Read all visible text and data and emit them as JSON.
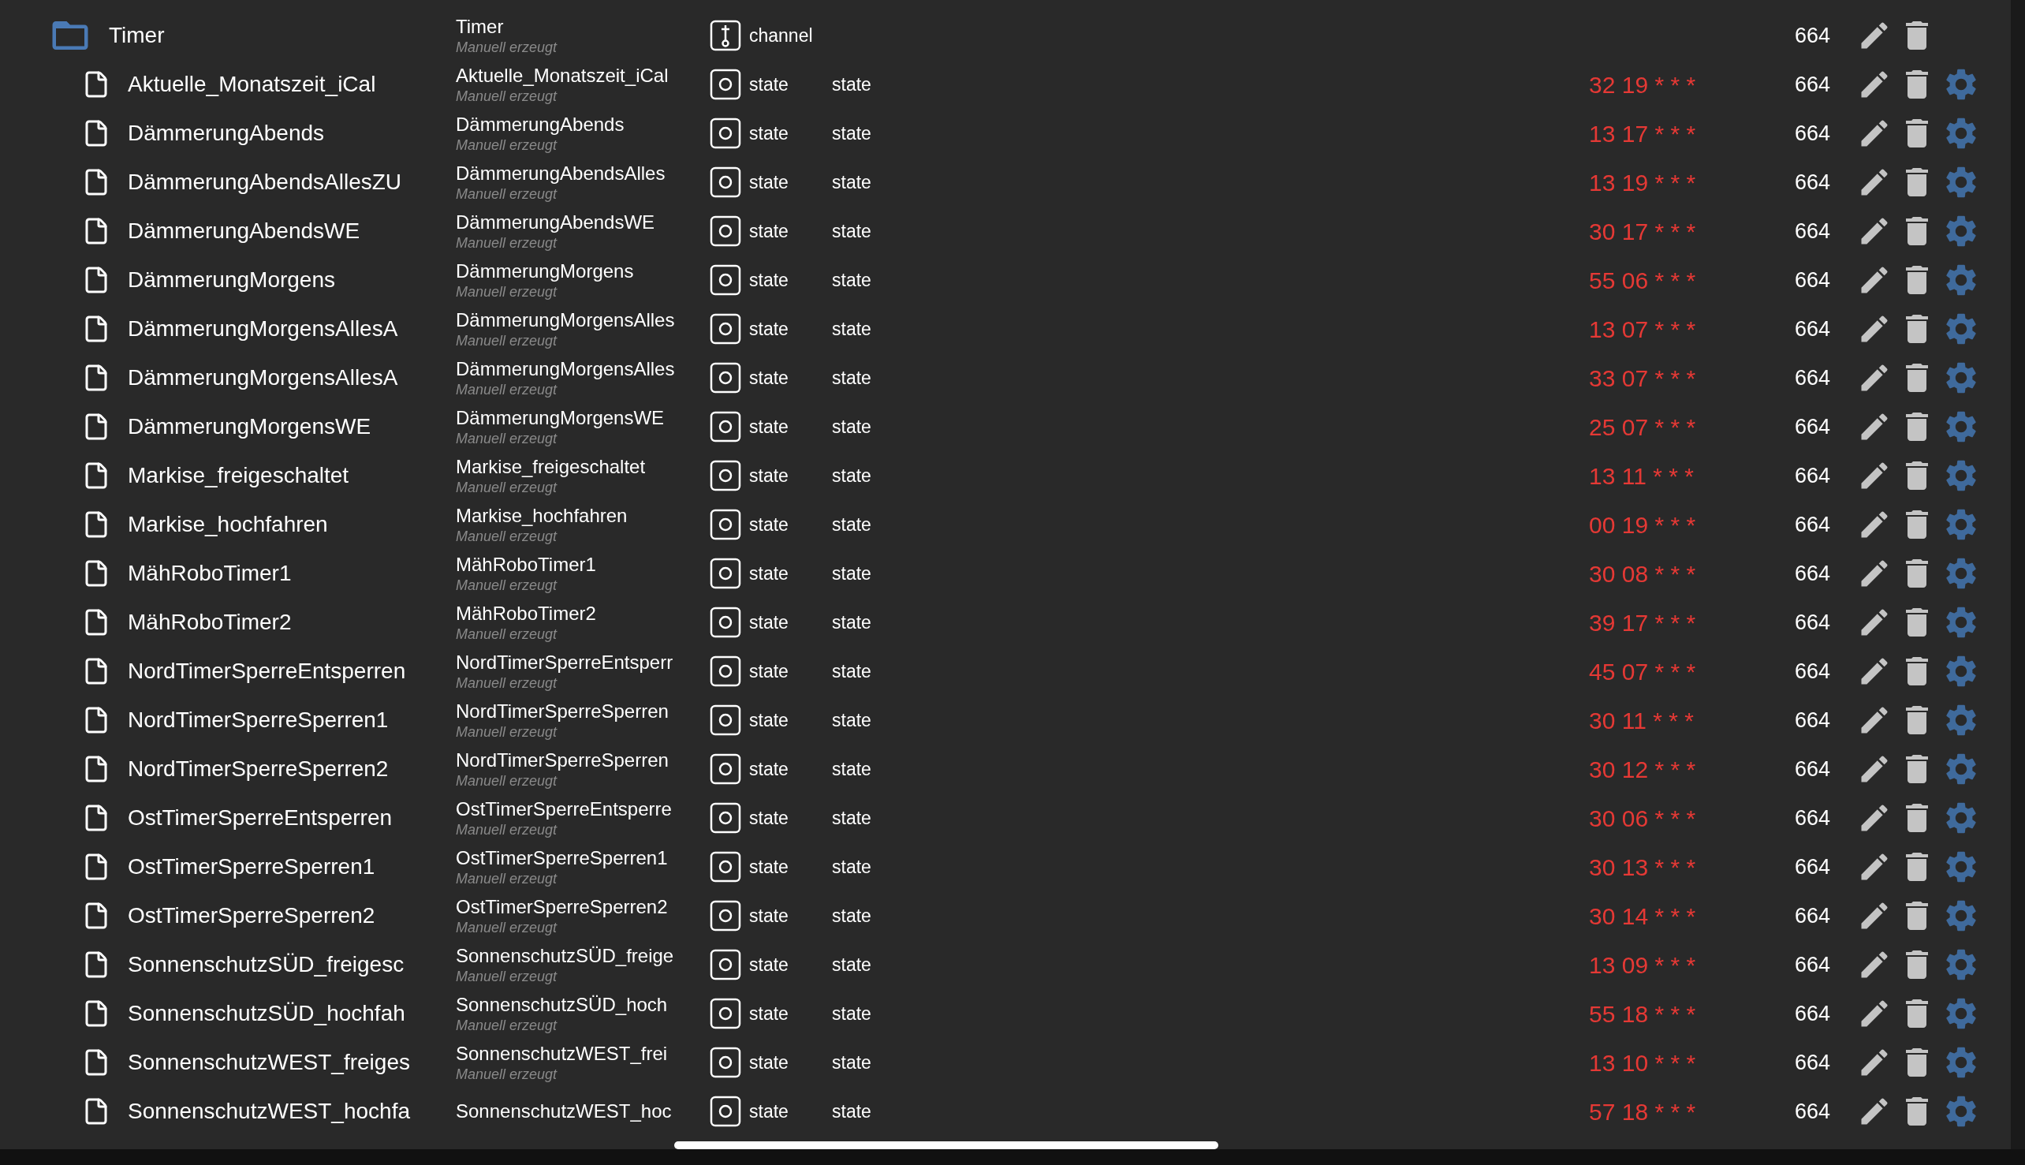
{
  "tree": {
    "kind": "channel",
    "expanded": true,
    "name": "Timer",
    "title": "Timer",
    "note": "Manuell erzeugt",
    "type": "channel",
    "acl": "664",
    "settings": false,
    "children": [
      {
        "kind": "state",
        "name": "Aktuelle_Monatszeit_iCal",
        "title": "Aktuelle_Monatszeit_iCal",
        "note": "Manuell erzeugt",
        "type": "state",
        "role": "state",
        "value": "32 19 * * *",
        "acl": "664",
        "settings": true
      },
      {
        "kind": "state",
        "name": "DämmerungAbends",
        "title": "DämmerungAbends",
        "note": "Manuell erzeugt",
        "type": "state",
        "role": "state",
        "value": "13 17 * * *",
        "acl": "664",
        "settings": true
      },
      {
        "kind": "state",
        "name": "DämmerungAbendsAllesZU",
        "title": "DämmerungAbendsAlles",
        "note": "Manuell erzeugt",
        "type": "state",
        "role": "state",
        "value": "13 19 * * *",
        "acl": "664",
        "settings": true
      },
      {
        "kind": "state",
        "name": "DämmerungAbendsWE",
        "title": "DämmerungAbendsWE",
        "note": "Manuell erzeugt",
        "type": "state",
        "role": "state",
        "value": "30 17 * * *",
        "acl": "664",
        "settings": true
      },
      {
        "kind": "state",
        "name": "DämmerungMorgens",
        "title": "DämmerungMorgens",
        "note": "Manuell erzeugt",
        "type": "state",
        "role": "state",
        "value": "55 06 * * *",
        "acl": "664",
        "settings": true
      },
      {
        "kind": "state",
        "name": "DämmerungMorgensAllesA",
        "title": "DämmerungMorgensAlles",
        "note": "Manuell erzeugt",
        "type": "state",
        "role": "state",
        "value": "13 07 * * *",
        "acl": "664",
        "settings": true
      },
      {
        "kind": "state",
        "name": "DämmerungMorgensAllesA",
        "title": "DämmerungMorgensAlles",
        "note": "Manuell erzeugt",
        "type": "state",
        "role": "state",
        "value": "33 07 * * *",
        "acl": "664",
        "settings": true
      },
      {
        "kind": "state",
        "name": "DämmerungMorgensWE",
        "title": "DämmerungMorgensWE",
        "note": "Manuell erzeugt",
        "type": "state",
        "role": "state",
        "value": "25 07 * * *",
        "acl": "664",
        "settings": true
      },
      {
        "kind": "state",
        "name": "Markise_freigeschaltet",
        "title": "Markise_freigeschaltet",
        "note": "Manuell erzeugt",
        "type": "state",
        "role": "state",
        "value": "13 11 * * *",
        "acl": "664",
        "settings": true
      },
      {
        "kind": "state",
        "name": "Markise_hochfahren",
        "title": "Markise_hochfahren",
        "note": "Manuell erzeugt",
        "type": "state",
        "role": "state",
        "value": "00 19 * * *",
        "acl": "664",
        "settings": true
      },
      {
        "kind": "state",
        "name": "MähRoboTimer1",
        "title": "MähRoboTimer1",
        "note": "Manuell erzeugt",
        "type": "state",
        "role": "state",
        "value": "30 08 * * *",
        "acl": "664",
        "settings": true
      },
      {
        "kind": "state",
        "name": "MähRoboTimer2",
        "title": "MähRoboTimer2",
        "note": "Manuell erzeugt",
        "type": "state",
        "role": "state",
        "value": "39 17 * * *",
        "acl": "664",
        "settings": true
      },
      {
        "kind": "state",
        "name": "NordTimerSperreEntsperren",
        "title": "NordTimerSperreEntsperr",
        "note": "Manuell erzeugt",
        "type": "state",
        "role": "state",
        "value": "45 07 * * *",
        "acl": "664",
        "settings": true
      },
      {
        "kind": "state",
        "name": "NordTimerSperreSperren1",
        "title": "NordTimerSperreSperren",
        "note": "Manuell erzeugt",
        "type": "state",
        "role": "state",
        "value": "30 11 * * *",
        "acl": "664",
        "settings": true
      },
      {
        "kind": "state",
        "name": "NordTimerSperreSperren2",
        "title": "NordTimerSperreSperren",
        "note": "Manuell erzeugt",
        "type": "state",
        "role": "state",
        "value": "30 12 * * *",
        "acl": "664",
        "settings": true
      },
      {
        "kind": "state",
        "name": "OstTimerSperreEntsperren",
        "title": "OstTimerSperreEntsperre",
        "note": "Manuell erzeugt",
        "type": "state",
        "role": "state",
        "value": "30 06 * * *",
        "acl": "664",
        "settings": true
      },
      {
        "kind": "state",
        "name": "OstTimerSperreSperren1",
        "title": "OstTimerSperreSperren1",
        "note": "Manuell erzeugt",
        "type": "state",
        "role": "state",
        "value": "30 13 * * *",
        "acl": "664",
        "settings": true
      },
      {
        "kind": "state",
        "name": "OstTimerSperreSperren2",
        "title": "OstTimerSperreSperren2",
        "note": "Manuell erzeugt",
        "type": "state",
        "role": "state",
        "value": "30 14 * * *",
        "acl": "664",
        "settings": true
      },
      {
        "kind": "state",
        "name": "SonnenschutzSÜD_freigesc",
        "title": "SonnenschutzSÜD_freige",
        "note": "Manuell erzeugt",
        "type": "state",
        "role": "state",
        "value": "13 09 * * *",
        "acl": "664",
        "settings": true
      },
      {
        "kind": "state",
        "name": "SonnenschutzSÜD_hochfah",
        "title": "SonnenschutzSÜD_hoch",
        "note": "Manuell erzeugt",
        "type": "state",
        "role": "state",
        "value": "55 18 * * *",
        "acl": "664",
        "settings": true
      },
      {
        "kind": "state",
        "name": "SonnenschutzWEST_freiges",
        "title": "SonnenschutzWEST_frei",
        "note": "Manuell erzeugt",
        "type": "state",
        "role": "state",
        "value": "13 10 * * *",
        "acl": "664",
        "settings": true
      },
      {
        "kind": "state",
        "name": "SonnenschutzWEST_hochfa",
        "title": "SonnenschutzWEST_hoc",
        "type": "state",
        "role": "state",
        "value": "57 18 * * *",
        "acl": "664",
        "settings": true
      }
    ]
  }
}
